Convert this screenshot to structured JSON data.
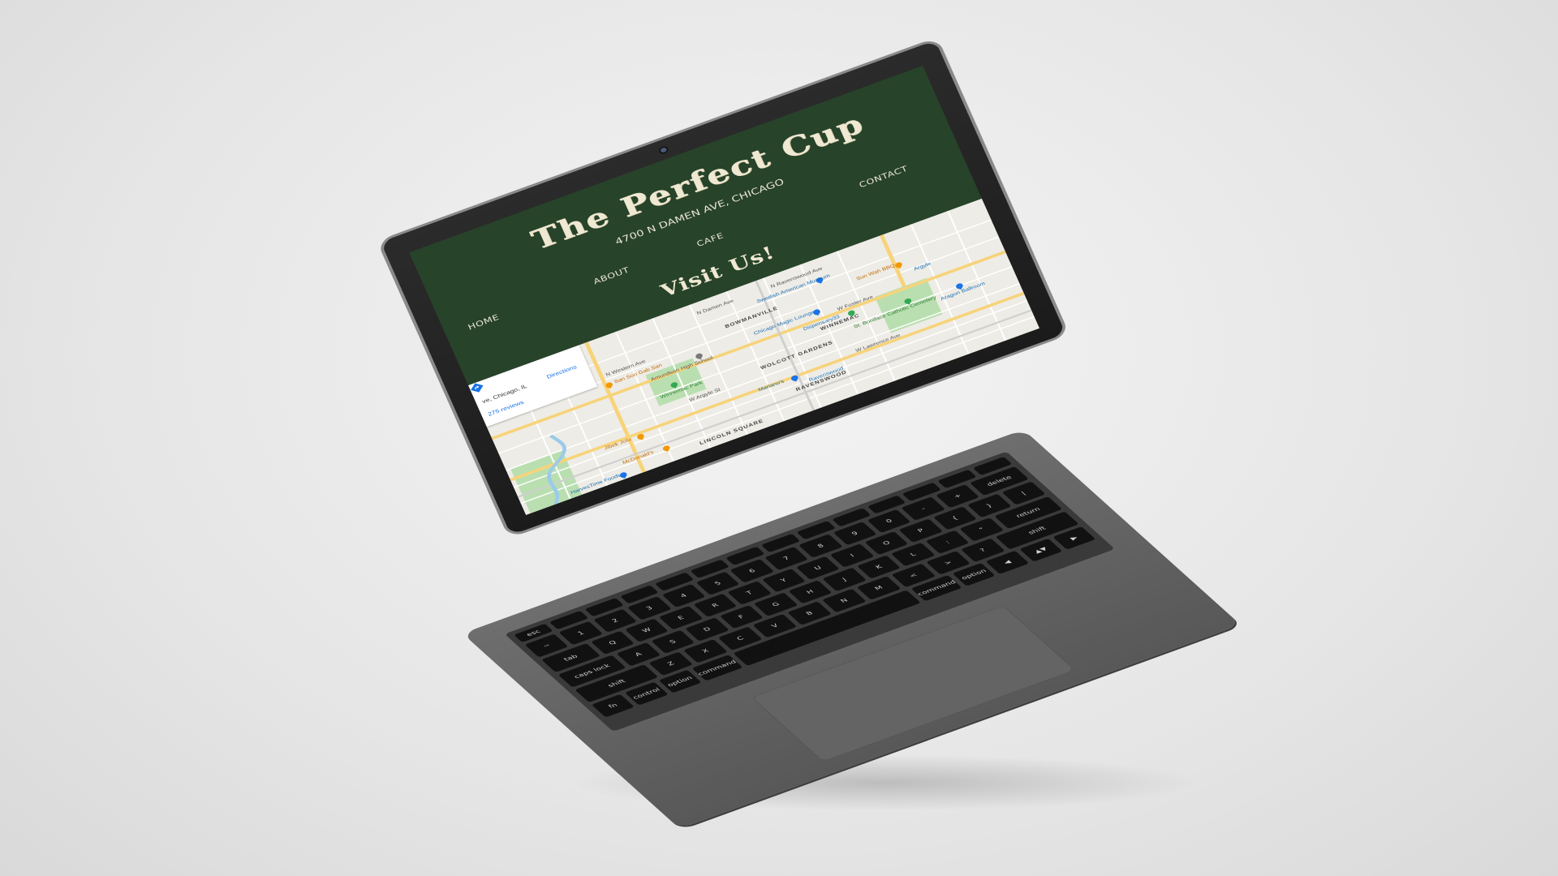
{
  "site": {
    "title": "The Perfect Cup",
    "address": "4700 N DAMEN AVE, CHICAGO",
    "nav": [
      {
        "label": "HOME"
      },
      {
        "label": "ABOUT"
      },
      {
        "label": "CAFE"
      },
      {
        "label": "CONTACT"
      }
    ],
    "visit_heading": "Visit Us!",
    "background_color": "#27432a",
    "text_color": "#efe8d2"
  },
  "map": {
    "card": {
      "address": "ve, Chicago, IL",
      "directions_label": "Directions",
      "reviews": "275 reviews"
    },
    "area_labels": [
      {
        "text": "BOWMANVILLE"
      },
      {
        "text": "WINNEMAC"
      },
      {
        "text": "WOLCOTT GARDENS"
      },
      {
        "text": "RAVENSWOOD"
      },
      {
        "text": "LINCOLN SQUARE"
      }
    ],
    "street_labels": [
      {
        "text": "W Foster Ave"
      },
      {
        "text": "W Lawrence Ave"
      },
      {
        "text": "W Argyle St"
      },
      {
        "text": "N Western Ave"
      },
      {
        "text": "N Damen Ave"
      },
      {
        "text": "N Ravenswood Ave"
      }
    ],
    "places": [
      {
        "name": "San Soo Gab San",
        "icon": "restaurant-pin-icon"
      },
      {
        "name": "Amundsen High School",
        "icon": "school-pin-icon"
      },
      {
        "name": "Winnemac Park",
        "icon": "park-pin-icon"
      },
      {
        "name": "Swedish American Museum",
        "icon": "museum-pin-icon"
      },
      {
        "name": "Chicago Magic Lounge",
        "icon": "venue-pin-icon"
      },
      {
        "name": "Sun Wah BBQ",
        "icon": "restaurant-pin-icon"
      },
      {
        "name": "Dispensary33",
        "icon": "shop-pin-icon"
      },
      {
        "name": "St. Boniface Catholic Cemetery",
        "icon": "cemetery-pin-icon"
      },
      {
        "name": "Aragon Ballroom",
        "icon": "venue-pin-icon"
      },
      {
        "name": "Jibek Jolu",
        "icon": "restaurant-pin-icon"
      },
      {
        "name": "McDonald's",
        "icon": "restaurant-pin-icon"
      },
      {
        "name": "Mariano's",
        "icon": "grocery-pin-icon"
      },
      {
        "name": "HarvesTime Foods",
        "icon": "grocery-pin-icon"
      },
      {
        "name": "Ravenswood",
        "icon": "transit-icon"
      },
      {
        "name": "Argyle",
        "icon": "transit-icon"
      }
    ]
  },
  "keyboard": {
    "rows": [
      [
        "esc",
        "",
        "",
        "",
        "",
        "",
        "",
        "",
        "",
        "",
        "",
        "",
        "",
        ""
      ],
      [
        "~",
        "1",
        "2",
        "3",
        "4",
        "5",
        "6",
        "7",
        "8",
        "9",
        "0",
        "-",
        "+",
        "delete"
      ],
      [
        "tab",
        "Q",
        "W",
        "E",
        "R",
        "T",
        "Y",
        "U",
        "I",
        "O",
        "P",
        "{",
        "}",
        "|"
      ],
      [
        "caps lock",
        "A",
        "S",
        "D",
        "F",
        "G",
        "H",
        "J",
        "K",
        "L",
        ":",
        "\"",
        "return"
      ],
      [
        "shift",
        "Z",
        "X",
        "C",
        "V",
        "B",
        "N",
        "M",
        "<",
        ">",
        "?",
        "shift"
      ],
      [
        "fn",
        "control",
        "option",
        "command",
        "",
        "command",
        "option",
        "◀",
        "▲▼",
        "▶"
      ]
    ]
  }
}
